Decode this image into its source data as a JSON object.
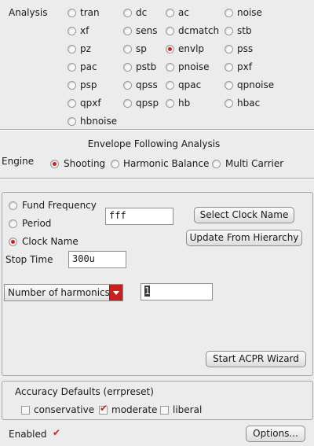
{
  "analysis": {
    "label": "Analysis",
    "selected": "envlp",
    "options": [
      "tran",
      "dc",
      "ac",
      "noise",
      "xf",
      "sens",
      "dcmatch",
      "stb",
      "pz",
      "sp",
      "envlp",
      "pss",
      "pac",
      "pstb",
      "pnoise",
      "pxf",
      "psp",
      "qpss",
      "qpac",
      "qpnoise",
      "qpxf",
      "qpsp",
      "hb",
      "hbac",
      "hbnoise"
    ]
  },
  "section_title": "Envelope Following Analysis",
  "engine": {
    "label": "Engine",
    "selected": "Shooting",
    "options": [
      "Shooting",
      "Harmonic Balance",
      "Multi Carrier"
    ]
  },
  "clock": {
    "selected": "Clock Name",
    "options": [
      "Fund Frequency",
      "Period",
      "Clock Name"
    ],
    "fund_value": "fff",
    "select_clock_button": "Select Clock Name",
    "update_hierarchy_button": "Update From Hierarchy",
    "stop_time_label": "Stop Time",
    "stop_time_value": "300u",
    "harmonics_select": "Number of harmonics",
    "harmonics_value": "1",
    "acpr_button": "Start ACPR Wizard"
  },
  "accuracy": {
    "title": "Accuracy Defaults (errpreset)",
    "selected": "moderate",
    "options": [
      "conservative",
      "moderate",
      "liberal"
    ]
  },
  "enabled": {
    "label": "Enabled",
    "checked": true
  },
  "options_button": "Options...",
  "colors": {
    "accent": "#d0201a",
    "background": "#ececec"
  }
}
